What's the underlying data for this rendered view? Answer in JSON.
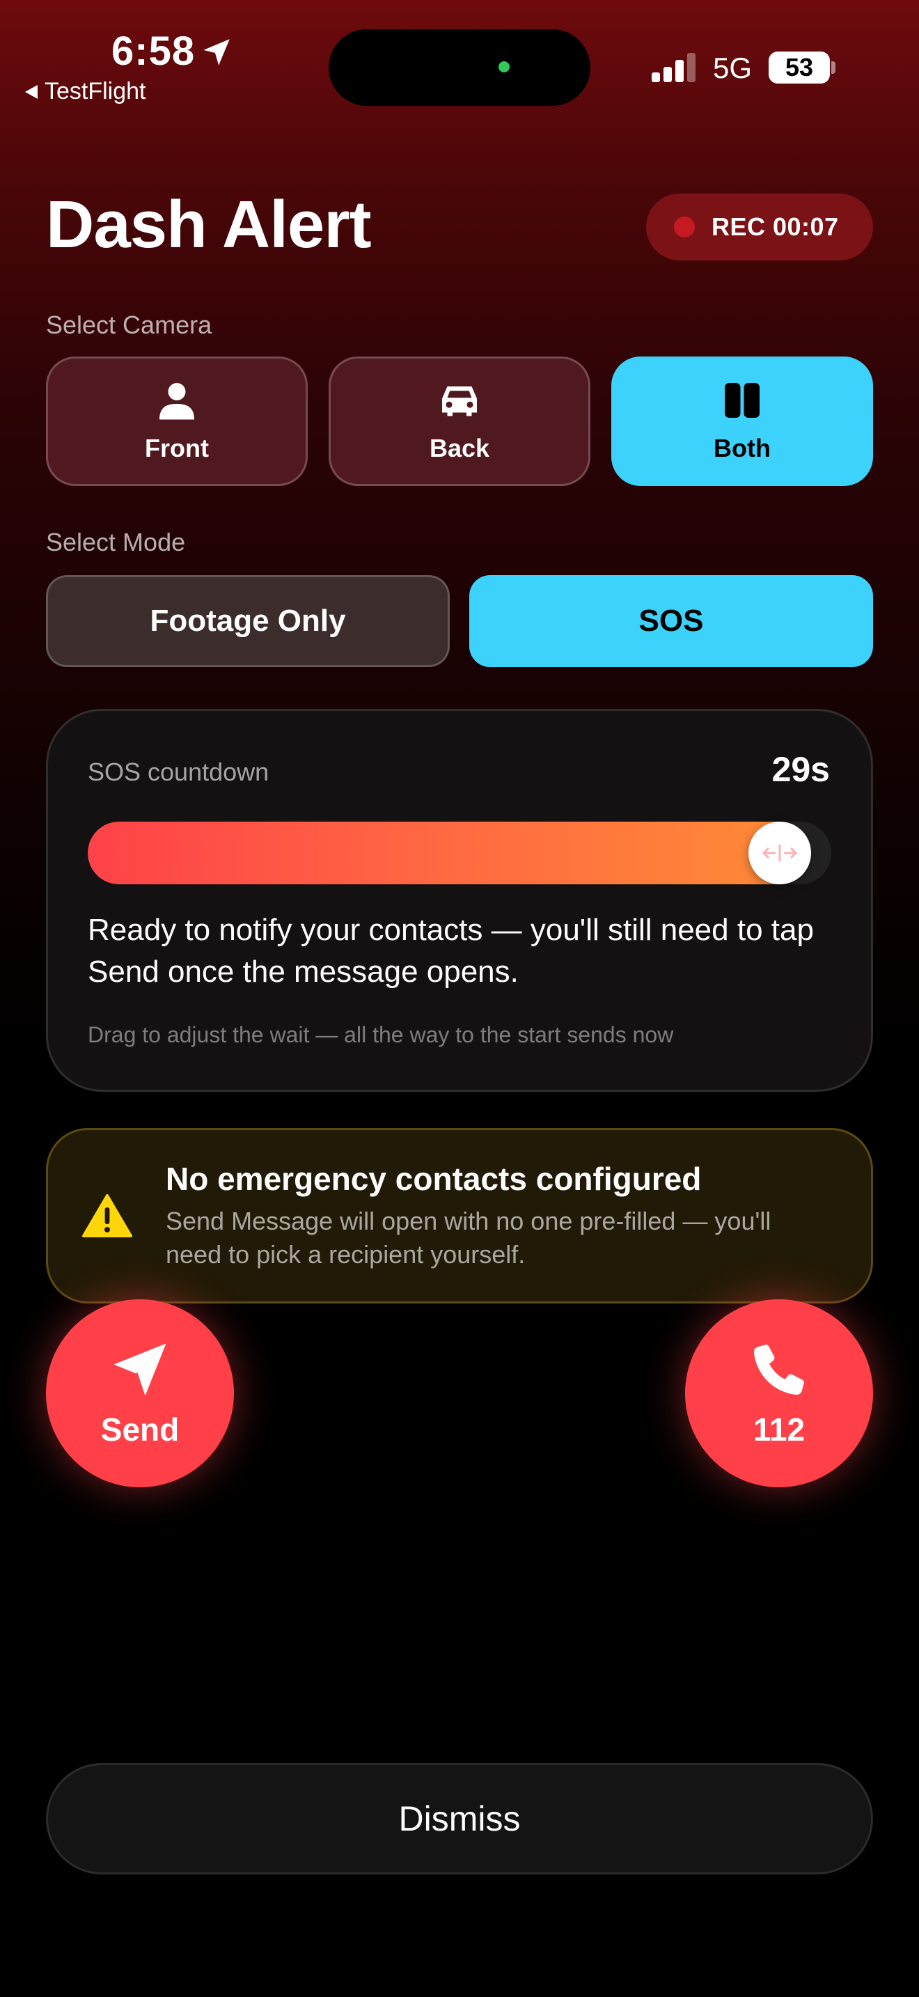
{
  "status_bar": {
    "time": "6:58",
    "back_app": "TestFlight",
    "network": "5G",
    "battery": "53",
    "icons": [
      "location-arrow-icon",
      "signal-icon",
      "battery-icon"
    ]
  },
  "header": {
    "title": "Dash Alert",
    "rec_label": "REC 00:07"
  },
  "camera": {
    "section_label": "Select Camera",
    "options": [
      {
        "label": "Front",
        "icon": "person-icon",
        "selected": false
      },
      {
        "label": "Back",
        "icon": "car-icon",
        "selected": false
      },
      {
        "label": "Both",
        "icon": "split-view-icon",
        "selected": true
      }
    ]
  },
  "mode": {
    "section_label": "Select Mode",
    "options": [
      {
        "label": "Footage Only",
        "selected": false
      },
      {
        "label": "SOS",
        "selected": true
      }
    ]
  },
  "countdown": {
    "label": "SOS countdown",
    "seconds": "29s",
    "progress": 0.97,
    "message": "Ready to notify your contacts — you'll still need to tap Send once the message opens.",
    "hint": "Drag to adjust the wait — all the way to the start sends now"
  },
  "warning": {
    "title": "No emergency contacts configured",
    "body": "Send Message will open with no one pre-filled — you'll need to pick a recipient yourself.",
    "icon": "warning-triangle-icon"
  },
  "actions": {
    "send_label": "Send",
    "call_label": "112",
    "dismiss_label": "Dismiss"
  },
  "colors": {
    "accent": "#3dd2fb",
    "danger": "#ff4048",
    "rec_bg": "#7a1216"
  }
}
